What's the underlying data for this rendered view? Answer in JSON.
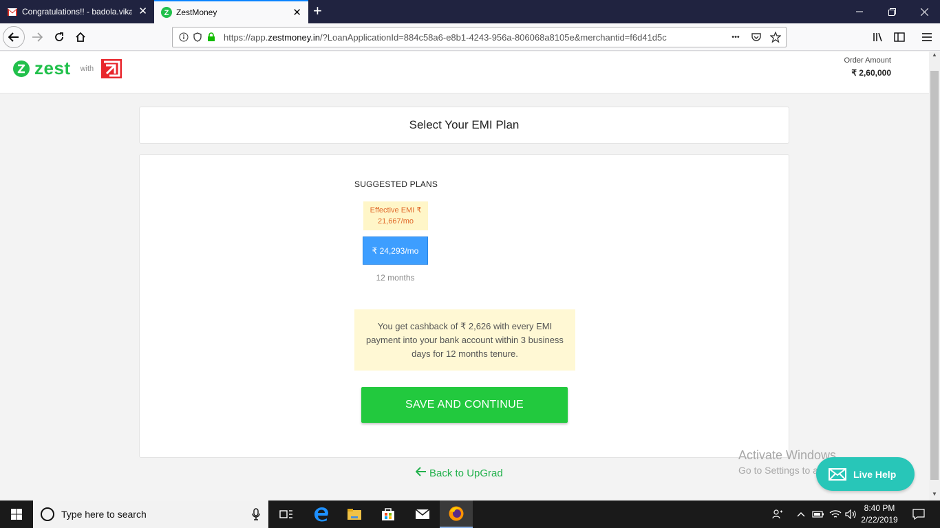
{
  "browser": {
    "tabs": [
      {
        "title": "Congratulations!! - badola.vika",
        "active": false
      },
      {
        "title": "ZestMoney",
        "active": true
      }
    ],
    "url_prefix": "https://app.",
    "url_domain": "zestmoney.in",
    "url_rest": "/?LoanApplicationId=884c58a6-e8b1-4243-956a-806068a8105e&merchantid=f6d41d5c",
    "more_glyph": "•••"
  },
  "header": {
    "brand": "zest",
    "with_label": "with",
    "order_amount_label": "Order Amount",
    "order_amount_value": "₹ 2,60,000"
  },
  "main": {
    "page_title": "Select Your EMI Plan",
    "suggested_plans_label": "SUGGESTED PLANS",
    "effective_emi_line1": "Effective EMI ₹",
    "effective_emi_line2": "21,667/mo",
    "plan_amount": "₹ 24,293/mo",
    "plan_tenure": "12 months",
    "cashback_text": "You get cashback of ₹ 2,626 with every EMI payment into your bank account within 3 business days for 12 months tenure.",
    "save_button": "SAVE AND CONTINUE",
    "back_link": "Back to UpGrad"
  },
  "overlay": {
    "activate_title": "Activate Windows",
    "activate_sub": "Go to Settings to activate Windows.",
    "live_help": "Live Help"
  },
  "taskbar": {
    "search_placeholder": "Type here to search",
    "time": "8:40 PM",
    "date": "2/22/2019"
  },
  "colors": {
    "brand_green": "#21c04b",
    "plan_blue": "#3d9eff",
    "save_green": "#22c93e",
    "live_help_teal": "#28c6b8"
  }
}
